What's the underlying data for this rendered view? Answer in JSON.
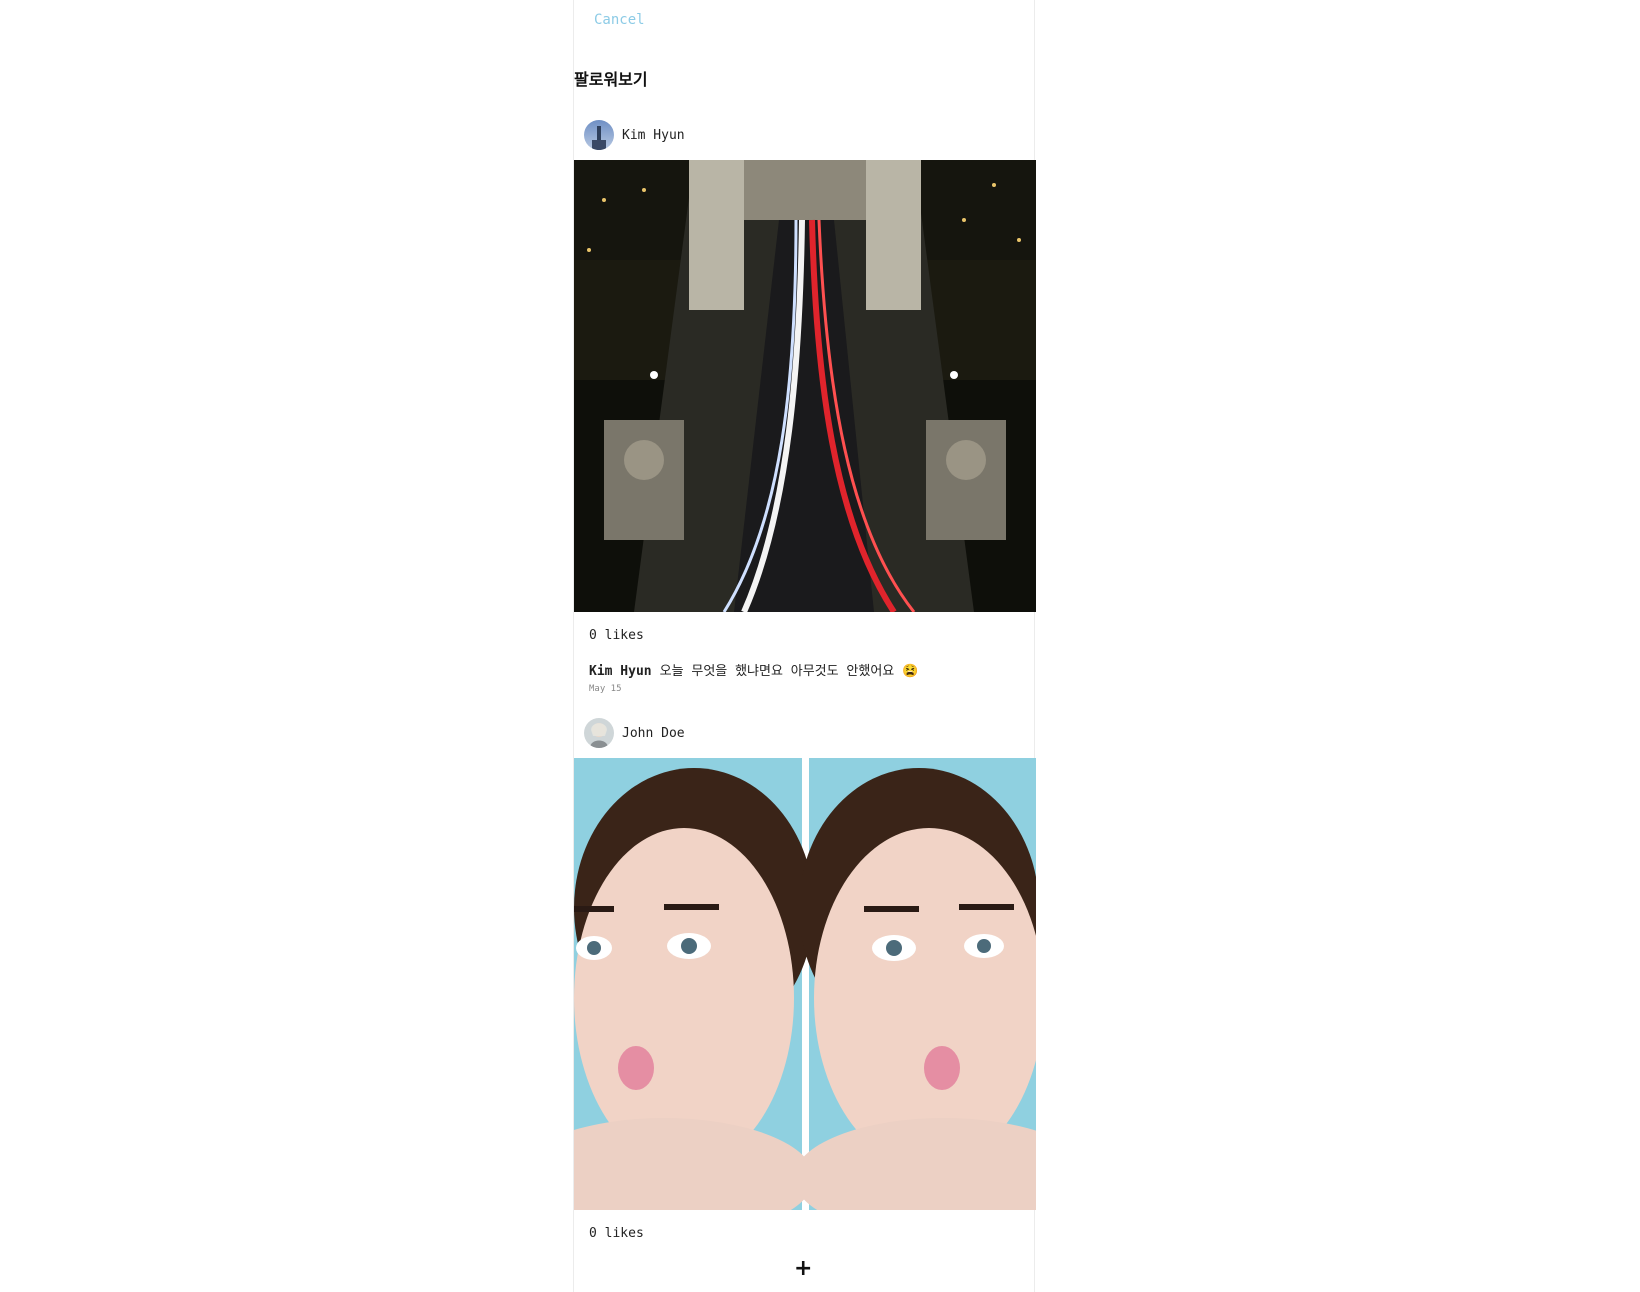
{
  "header": {
    "cancel_label": "Cancel",
    "title": "팔로워보기"
  },
  "posts": [
    {
      "username": "Kim Hyun",
      "likes": "0 likes",
      "caption_user": "Kim Hyun",
      "caption_text": "오늘 무엇을 했냐면요 아무것도 안했어요",
      "emoji": "😫",
      "date": "May 15",
      "image_subject": "night bridge with light trails"
    },
    {
      "username": "John Doe",
      "likes": "0 likes",
      "image_subject": "two portrait photos of a woman"
    }
  ],
  "footer": {
    "add_label": "+"
  },
  "colors": {
    "cancel": "#8ccbe6",
    "background": "#ffffff"
  }
}
